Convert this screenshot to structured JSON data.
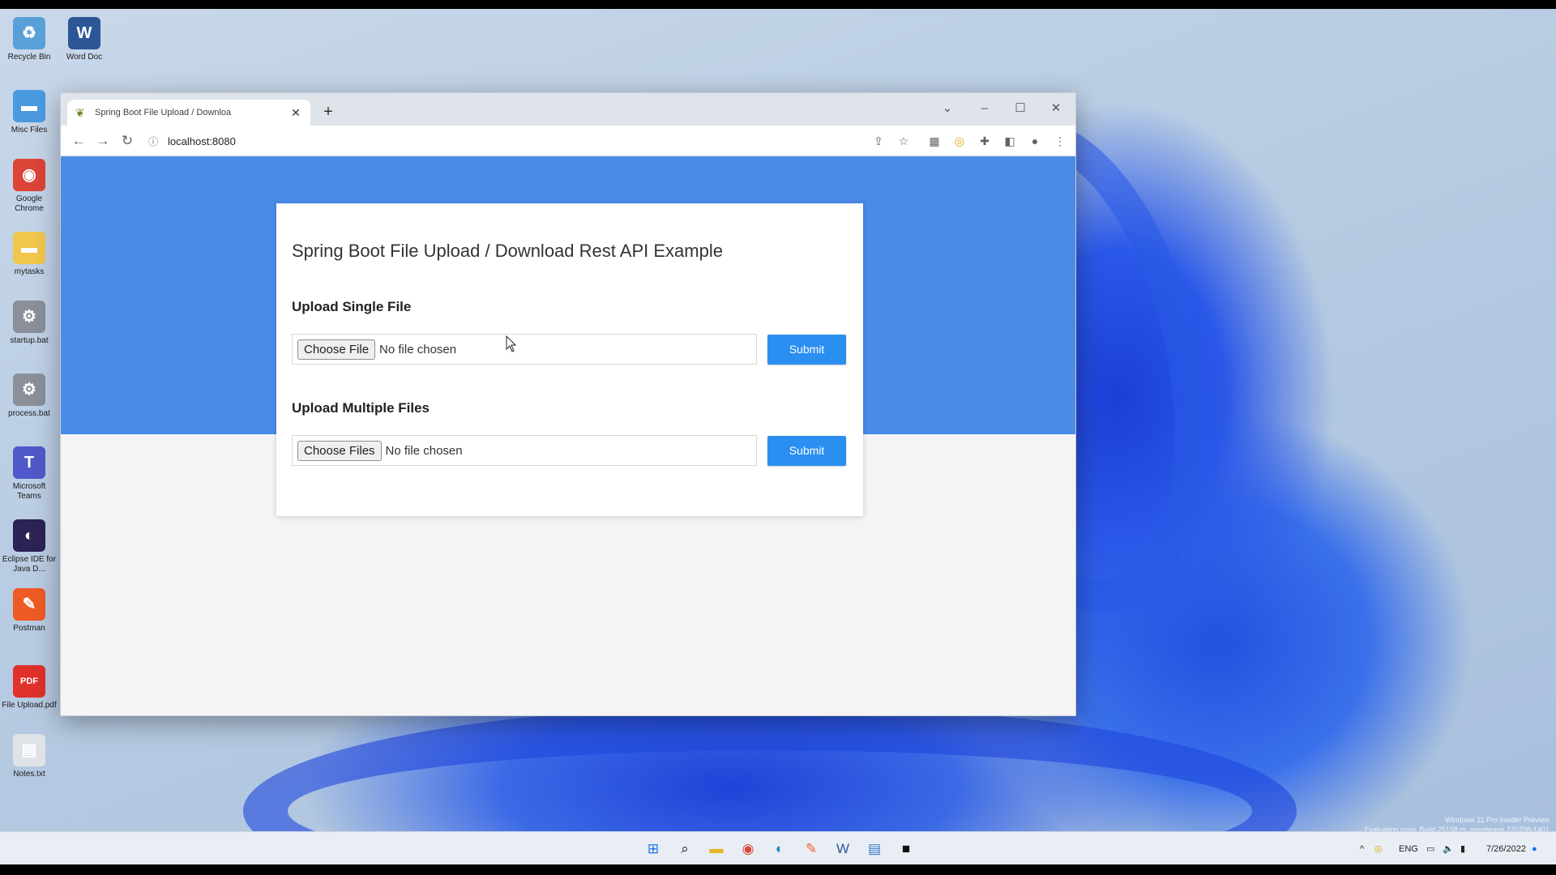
{
  "desktop": {
    "icons": [
      {
        "label": "Recycle Bin",
        "icon": "recycle-bin-icon",
        "glyph": "♻",
        "color": "#5aa0d8"
      },
      {
        "label": "Word Doc",
        "icon": "word-icon",
        "glyph": "W",
        "color": "#2b5797"
      },
      {
        "label": "Misc Files",
        "icon": "folder-icon",
        "glyph": "▬",
        "color": "#4a9ae0"
      },
      {
        "label": "Google Chrome",
        "icon": "chrome-icon",
        "glyph": "◉",
        "color": "#db4437"
      },
      {
        "label": "mytasks",
        "icon": "folder-icon",
        "glyph": "▬",
        "color": "#f0c64b"
      },
      {
        "label": "startup.bat",
        "icon": "gear-file-icon",
        "glyph": "⚙",
        "color": "#8a8f99"
      },
      {
        "label": "process.bat",
        "icon": "gear-file-icon",
        "glyph": "⚙",
        "color": "#8a8f99"
      },
      {
        "label": "Microsoft Teams",
        "icon": "teams-icon",
        "glyph": "T",
        "color": "#5059c9"
      },
      {
        "label": "Eclipse IDE for Java D...",
        "icon": "eclipse-icon",
        "glyph": "◐",
        "color": "#2c2255"
      },
      {
        "label": "Postman",
        "icon": "postman-icon",
        "glyph": "✎",
        "color": "#ef5b25"
      },
      {
        "label": "File Upload.pdf",
        "icon": "pdf-icon",
        "glyph": "PDF",
        "color": "#e0312b"
      },
      {
        "label": "Notes.txt",
        "icon": "text-file-icon",
        "glyph": "▤",
        "color": "#dfe3e8"
      }
    ]
  },
  "browser": {
    "tab_title": "Spring Boot File Upload / Downloa",
    "tab_close": "✕",
    "new_tab": "+",
    "url": "localhost:8080",
    "window_controls": {
      "tabsearch": "⌄",
      "minimize": "–",
      "maximize": "☐",
      "close": "✕"
    }
  },
  "page": {
    "heading": "Spring Boot File Upload / Download Rest API Example",
    "single": {
      "title": "Upload Single File",
      "choose_label": "Choose File",
      "status": "No file chosen",
      "submit": "Submit"
    },
    "multiple": {
      "title": "Upload Multiple Files",
      "choose_label": "Choose Files",
      "status": "No file chosen",
      "submit": "Submit"
    }
  },
  "taskbar": {
    "lang": "ENG",
    "date": "7/26/2022",
    "chevron": "^"
  },
  "watermark": {
    "line1": "Windows 11 Pro Insider Preview",
    "line2": "Evaluation copy. Build 25158.rs_prerelease.220708-1401"
  },
  "colors": {
    "page_band": "#4a8be7",
    "submit": "#2b8ef1"
  }
}
